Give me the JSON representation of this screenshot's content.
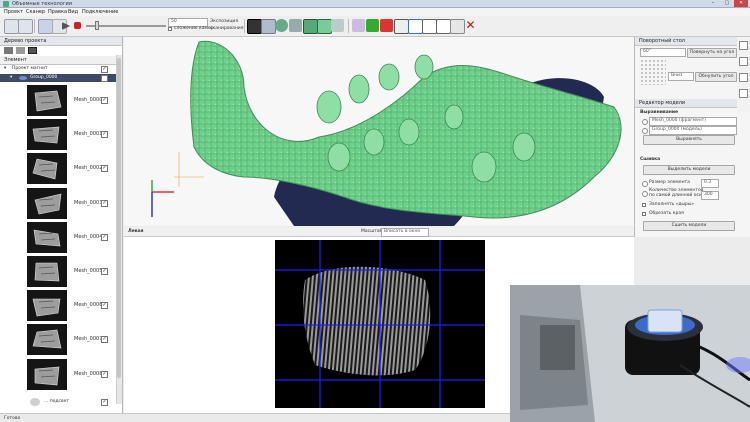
{
  "window": {
    "title": "Объемные технологии"
  },
  "menu": [
    "Проект",
    "Сканер",
    "Правка",
    "Вид",
    "Подключение"
  ],
  "toolbar": {
    "field_value": "50",
    "checkbox_label": "сложение камер",
    "exposure_label": "Экспозиция",
    "exposure_sublabel": "сканирования",
    "colors": {
      "green": "#38a838",
      "red": "#d02020",
      "blue": "#3c6fc8"
    }
  },
  "project_tree": {
    "title": "Дерево проекта",
    "column_header": "Элемент",
    "project_label": "Проект магнит",
    "group_label": "Group_0000",
    "meshes": [
      "Mesh_0000",
      "Mesh_0001",
      "Mesh_0002",
      "Mesh_0003",
      "Mesh_0004",
      "Mesh_0005",
      "Mesh_0006",
      "Mesh_0007",
      "Mesh_0008"
    ],
    "last_item": "... подсвет"
  },
  "camera_view": {
    "title": "Левая",
    "scale_label": "Масштаб",
    "scale_value": "Вписать в окно"
  },
  "turntable": {
    "title": "Поворотный стол",
    "angle_value": "60°",
    "rotate_button": "Повернуть на угол",
    "dir_value": "Вниз",
    "reset_button": "Обнулить угол"
  },
  "model_editor": {
    "title": "Редактор модели",
    "align_section": "Выравнивание",
    "option1": "Mesh_0000 (фрагмент)",
    "option2": "Group_0000 (модель)",
    "align_button": "Выровнять",
    "merge_section": "Сшивка",
    "select_models_button": "Выделить модели",
    "element_size_label": "Размер элемента",
    "element_size_value": "0.3",
    "vertex_count_label": "Количество элементов",
    "vertex_count_sub": "по самой длинной оси",
    "vertex_count_value": "300",
    "fill_holes_label": "Заполнять «дыры»",
    "trim_edges_label": "Обрезать края",
    "merge_button": "Сшить модели"
  },
  "status": {
    "text": "Готово"
  },
  "viewport": {
    "model_color": "#6fd08c",
    "shadow_color": "#232a52"
  }
}
